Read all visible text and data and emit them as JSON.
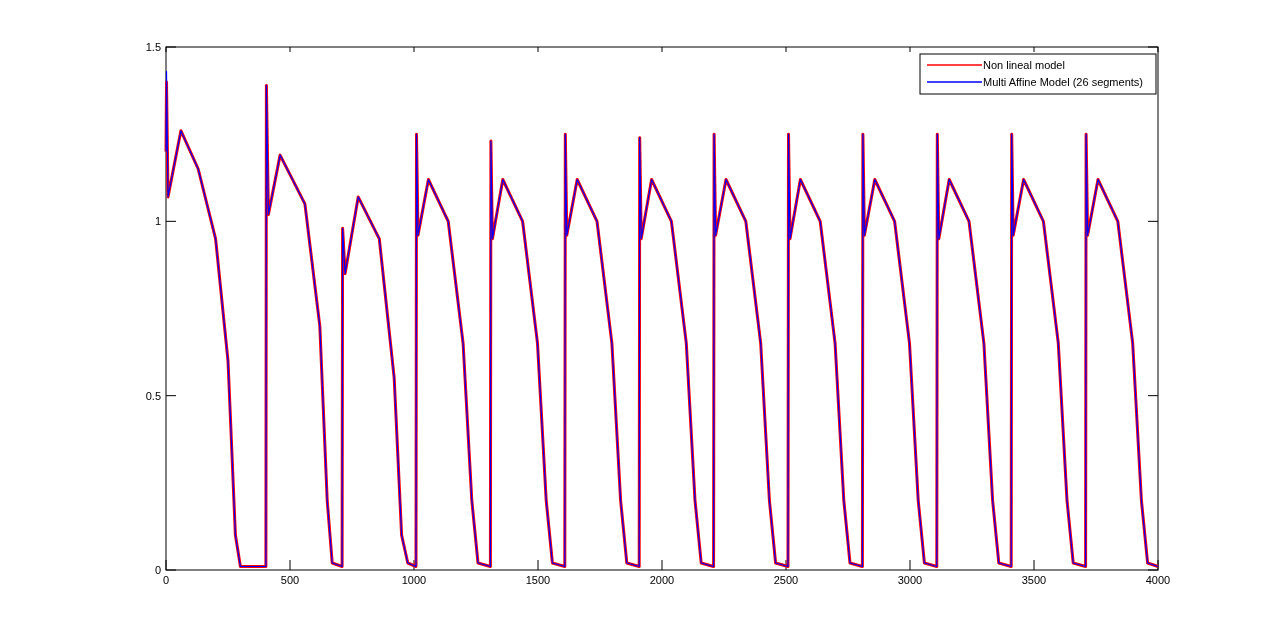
{
  "figure": {
    "chart_data": {
      "type": "line",
      "legend": true,
      "xlim": [
        0,
        4000
      ],
      "ylim": [
        0,
        1.5
      ],
      "xticks": [
        0,
        500,
        1000,
        1500,
        2000,
        2500,
        3000,
        3500,
        4000
      ],
      "yticks": [
        0,
        0.5,
        1,
        1.5
      ],
      "x": [
        0,
        2,
        8,
        60,
        130,
        200,
        250,
        280,
        300,
        403,
        405,
        413,
        460,
        560,
        620,
        650,
        670,
        710,
        712,
        722,
        775,
        860,
        920,
        950,
        975,
        1008,
        1010,
        1016,
        1058,
        1138,
        1198,
        1233,
        1258,
        1308,
        1310,
        1316,
        1358,
        1438,
        1498,
        1533,
        1558,
        1608,
        1610,
        1616,
        1658,
        1738,
        1798,
        1833,
        1858,
        1908,
        1910,
        1916,
        1958,
        2038,
        2098,
        2133,
        2158,
        2208,
        2210,
        2216,
        2258,
        2338,
        2398,
        2433,
        2458,
        2508,
        2510,
        2516,
        2558,
        2638,
        2698,
        2733,
        2758,
        2808,
        2810,
        2816,
        2858,
        2938,
        2998,
        3033,
        3058,
        3108,
        3110,
        3116,
        3158,
        3238,
        3298,
        3333,
        3358,
        3408,
        3410,
        3416,
        3458,
        3538,
        3598,
        3633,
        3658,
        3708,
        3710,
        3716,
        3758,
        3838,
        3898,
        3933,
        3958,
        4000
      ],
      "series": [
        {
          "name": "Non lineal model",
          "color": "#ff0000",
          "values": [
            1.2,
            1.4,
            1.07,
            1.26,
            1.15,
            0.95,
            0.6,
            0.1,
            0.01,
            0.01,
            1.39,
            1.02,
            1.19,
            1.05,
            0.7,
            0.2,
            0.02,
            0.01,
            0.98,
            0.85,
            1.07,
            0.95,
            0.55,
            0.1,
            0.02,
            0.01,
            1.25,
            0.96,
            1.12,
            1.0,
            0.65,
            0.2,
            0.02,
            0.01,
            1.23,
            0.95,
            1.12,
            1.0,
            0.65,
            0.2,
            0.02,
            0.01,
            1.25,
            0.96,
            1.12,
            1.0,
            0.65,
            0.2,
            0.02,
            0.01,
            1.24,
            0.95,
            1.12,
            1.0,
            0.65,
            0.2,
            0.02,
            0.01,
            1.25,
            0.96,
            1.12,
            1.0,
            0.65,
            0.2,
            0.02,
            0.01,
            1.25,
            0.95,
            1.12,
            1.0,
            0.65,
            0.2,
            0.02,
            0.01,
            1.25,
            0.96,
            1.12,
            1.0,
            0.65,
            0.2,
            0.02,
            0.01,
            1.25,
            0.95,
            1.12,
            1.0,
            0.65,
            0.2,
            0.02,
            0.01,
            1.25,
            0.96,
            1.12,
            1.0,
            0.65,
            0.2,
            0.02,
            0.01,
            1.25,
            0.96,
            1.12,
            1.0,
            0.65,
            0.2,
            0.02,
            0.01
          ]
        },
        {
          "name": "Multi Affine Model (26 segments)",
          "color": "#0000ff",
          "values": [
            1.2,
            1.43,
            1.07,
            1.26,
            1.15,
            0.95,
            0.6,
            0.1,
            0.01,
            0.01,
            1.39,
            1.02,
            1.19,
            1.05,
            0.7,
            0.2,
            0.02,
            0.01,
            0.98,
            0.85,
            1.07,
            0.95,
            0.55,
            0.1,
            0.02,
            0.01,
            1.25,
            0.96,
            1.12,
            1.0,
            0.65,
            0.2,
            0.02,
            0.01,
            1.23,
            0.95,
            1.12,
            1.0,
            0.65,
            0.2,
            0.02,
            0.01,
            1.25,
            0.96,
            1.12,
            1.0,
            0.65,
            0.2,
            0.02,
            0.01,
            1.24,
            0.95,
            1.12,
            1.0,
            0.65,
            0.2,
            0.02,
            0.01,
            1.25,
            0.96,
            1.12,
            1.0,
            0.65,
            0.2,
            0.02,
            0.01,
            1.25,
            0.95,
            1.12,
            1.0,
            0.65,
            0.2,
            0.02,
            0.01,
            1.25,
            0.96,
            1.12,
            1.0,
            0.65,
            0.2,
            0.02,
            0.01,
            1.25,
            0.95,
            1.12,
            1.0,
            0.65,
            0.2,
            0.02,
            0.01,
            1.25,
            0.96,
            1.12,
            1.0,
            0.65,
            0.2,
            0.02,
            0.01,
            1.25,
            0.96,
            1.12,
            1.0,
            0.65,
            0.2,
            0.02,
            0.01
          ]
        }
      ]
    }
  }
}
